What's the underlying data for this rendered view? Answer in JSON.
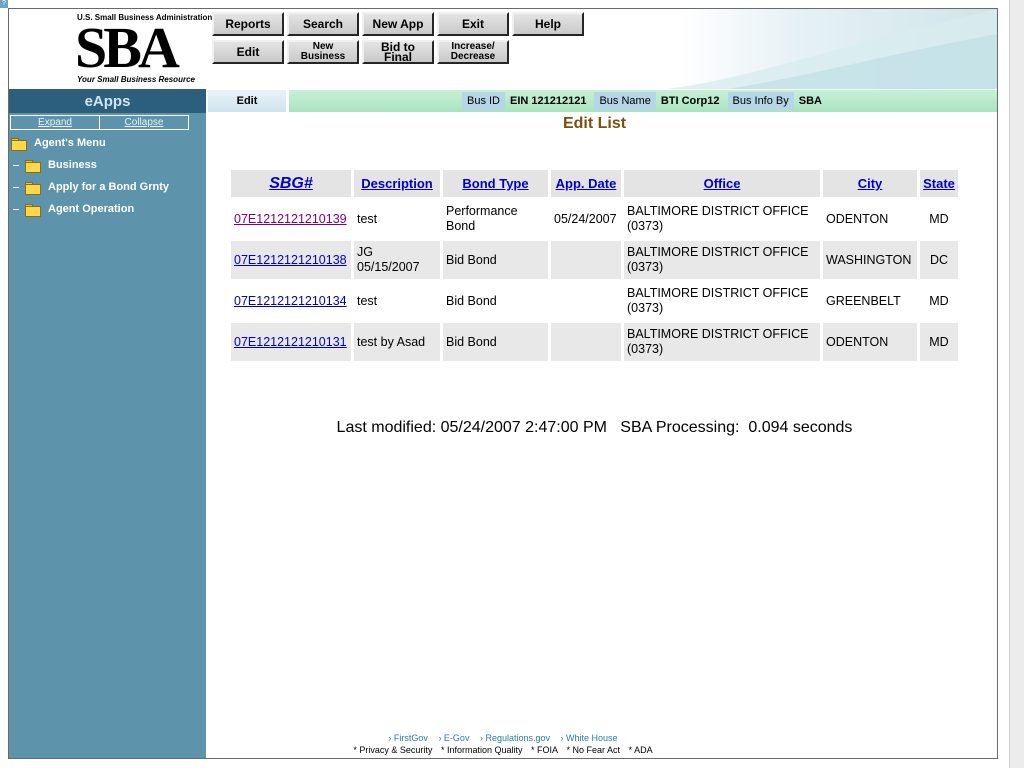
{
  "header": {
    "logo_top": "U.S. Small Business Administration",
    "logo_text": "SBA",
    "logo_tagline": "Your Small Business Resource",
    "buttons_row1": [
      "Reports",
      "Search",
      "New App",
      "Exit",
      "Help"
    ],
    "buttons_row2": [
      "Edit",
      "New Business",
      "Bid to Final",
      "Increase/ Decrease"
    ]
  },
  "sidebar": {
    "title": "eApps",
    "expand": "Expand",
    "collapse": "Collapse",
    "menu_title": "Agent's Menu",
    "items": [
      "Business",
      "Apply for a Bond Grnty",
      "Agent Operation"
    ]
  },
  "infobar": {
    "tab": "Edit",
    "bus_id_label": "Bus ID",
    "bus_id_value": "EIN 121212121",
    "bus_name_label": "Bus Name",
    "bus_name_value": "BTI Corp12",
    "bus_info_label": "Bus Info By",
    "bus_info_value": "SBA"
  },
  "main": {
    "title": "Edit List",
    "columns": [
      "SBG#",
      "Description",
      "Bond Type",
      "App. Date",
      "Office",
      "City",
      "State"
    ],
    "rows": [
      {
        "sbg": "07E1212121210139",
        "description": "test",
        "bond_type": "Performance Bond",
        "app_date": "05/24/2007",
        "office": "BALTIMORE DISTRICT OFFICE (0373)",
        "city": "ODENTON",
        "state": "MD"
      },
      {
        "sbg": "07E1212121210138",
        "description": "JG 05/15/2007",
        "bond_type": "Bid Bond",
        "app_date": "",
        "office": "BALTIMORE DISTRICT OFFICE (0373)",
        "city": "WASHINGTON",
        "state": "DC"
      },
      {
        "sbg": "07E1212121210134",
        "description": "test",
        "bond_type": "Bid Bond",
        "app_date": "",
        "office": "BALTIMORE DISTRICT OFFICE (0373)",
        "city": "GREENBELT",
        "state": "MD"
      },
      {
        "sbg": "07E1212121210131",
        "description": "test by Asad",
        "bond_type": "Bid Bond",
        "app_date": "",
        "office": "BALTIMORE DISTRICT OFFICE (0373)",
        "city": "ODENTON",
        "state": "MD"
      }
    ],
    "status": "Last modified: 05/24/2007 2:47:00 PM   SBA Processing:  0.094 seconds"
  },
  "footer": {
    "links": [
      "› FirstGov",
      "› E-Gov",
      "› Regulations.gov",
      "› White House"
    ],
    "policies": [
      "* Privacy & Security",
      "* Information Quality",
      "* FOIA",
      "* No Fear Act",
      "* ADA"
    ]
  },
  "colors": {
    "sidebar": "#5e93ac",
    "sidebar_header": "#2c5f7e",
    "info_bar": "#a9e4bf",
    "title": "#7a4f10",
    "link": "#0000cc",
    "visited_link": "#800080"
  }
}
